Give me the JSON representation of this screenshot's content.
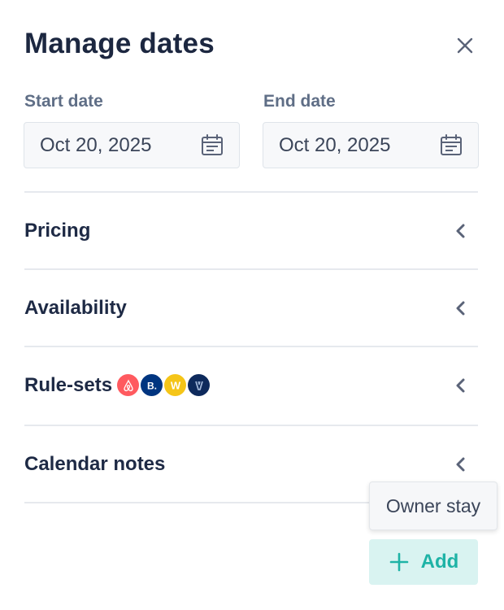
{
  "header": {
    "title": "Manage dates",
    "close_icon": "close-icon"
  },
  "dates": {
    "start": {
      "label": "Start date",
      "value": "Oct 20, 2025",
      "icon": "calendar-icon"
    },
    "end": {
      "label": "End date",
      "value": "Oct 20, 2025",
      "icon": "calendar-icon"
    }
  },
  "sections": [
    {
      "label": "Pricing",
      "icon": "chevron-left-icon"
    },
    {
      "label": "Availability",
      "icon": "chevron-left-icon"
    },
    {
      "label": "Rule-sets",
      "icon": "chevron-left-icon",
      "channels": [
        {
          "name": "airbnb-icon",
          "color": "#ff5a5f"
        },
        {
          "name": "booking-icon",
          "color": "#003580",
          "glyph": "B."
        },
        {
          "name": "w-channel-icon",
          "color": "#f5c518",
          "glyph": "W"
        },
        {
          "name": "vrbo-icon",
          "color": "#0e2a5c"
        }
      ]
    },
    {
      "label": "Calendar notes",
      "icon": "chevron-left-icon"
    }
  ],
  "tooltip": {
    "text": "Owner stay"
  },
  "add_button": {
    "label": "Add",
    "icon": "plus-icon"
  },
  "colors": {
    "accent": "#1eb3a6",
    "accent_bg": "#d9f3f1",
    "text": "#1e2a45",
    "muted": "#5f6e86"
  }
}
